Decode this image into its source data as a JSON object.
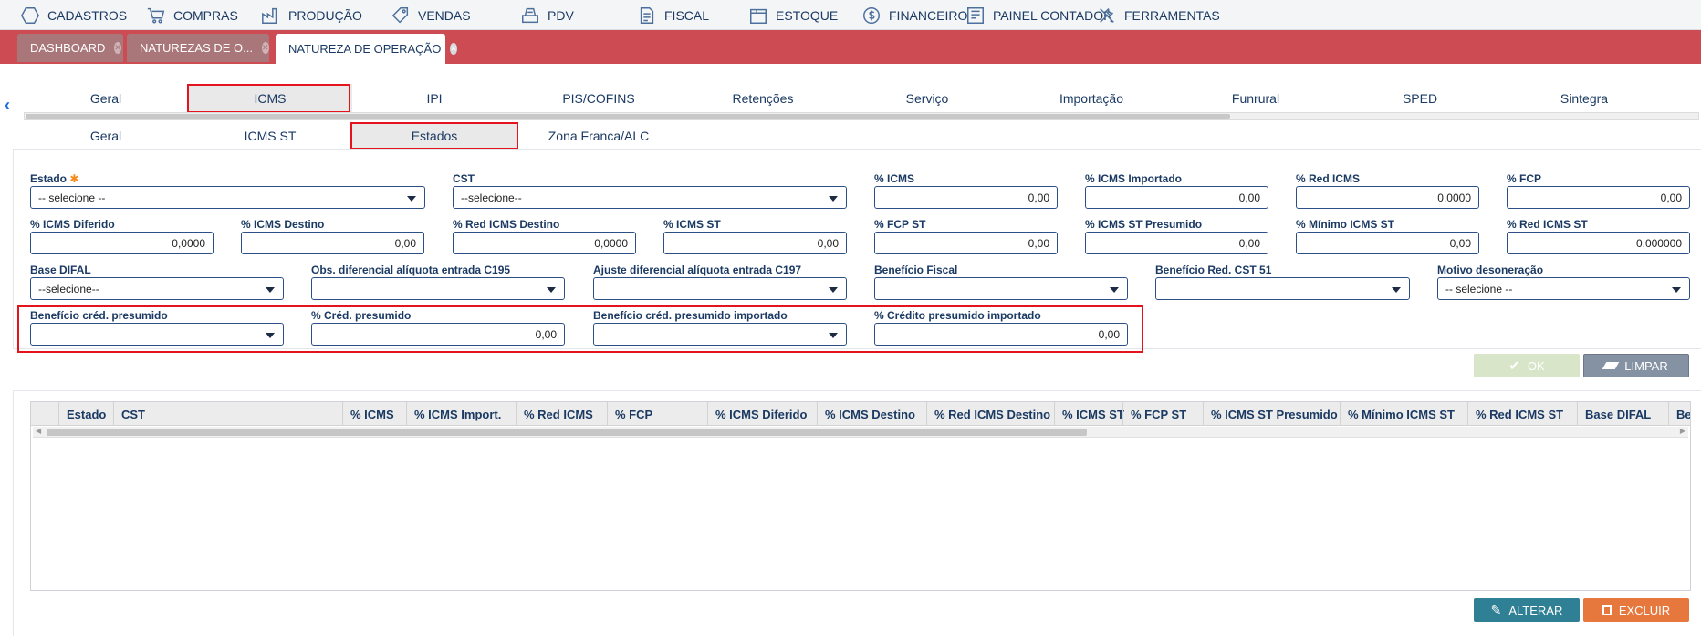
{
  "top_menu": [
    {
      "label": "CADASTROS",
      "icon": "hexagon-icon"
    },
    {
      "label": "COMPRAS",
      "icon": "cart-icon"
    },
    {
      "label": "PRODUÇÃO",
      "icon": "factory-icon"
    },
    {
      "label": "VENDAS",
      "icon": "tag-icon"
    },
    {
      "label": "PDV",
      "icon": "register-icon"
    },
    {
      "label": "FISCAL",
      "icon": "document-icon"
    },
    {
      "label": "ESTOQUE",
      "icon": "box-icon"
    },
    {
      "label": "FINANCEIRO",
      "icon": "dollar-icon"
    },
    {
      "label": "PAINEL CONTADOR",
      "icon": "panel-icon"
    },
    {
      "label": "FERRAMENTAS",
      "icon": "tools-icon"
    }
  ],
  "doc_tabs": [
    {
      "label": "DASHBOARD",
      "active": false
    },
    {
      "label": "NATUREZAS DE O...",
      "active": false
    },
    {
      "label": "NATUREZA DE OPERAÇÃO",
      "active": true
    }
  ],
  "main_tabs": [
    "Geral",
    "ICMS",
    "IPI",
    "PIS/COFINS",
    "Retenções",
    "Serviço",
    "Importação",
    "Funrural",
    "SPED",
    "Sintegra"
  ],
  "main_tab_selected": "ICMS",
  "sub_tabs": [
    "Geral",
    "ICMS ST",
    "Estados",
    "Zona Franca/ALC"
  ],
  "sub_tab_selected": "Estados",
  "form": {
    "estado": {
      "label": "Estado",
      "value": "-- selecione --"
    },
    "cst": {
      "label": "CST",
      "value": "--selecione--"
    },
    "pct_icms": {
      "label": "% ICMS",
      "value": "0,00"
    },
    "pct_icms_importado": {
      "label": "% ICMS Importado",
      "value": "0,00"
    },
    "pct_red_icms": {
      "label": "% Red ICMS",
      "value": "0,0000"
    },
    "pct_fcp": {
      "label": "% FCP",
      "value": "0,00"
    },
    "pct_icms_diferido": {
      "label": "% ICMS Diferido",
      "value": "0,0000"
    },
    "pct_icms_destino": {
      "label": "% ICMS Destino",
      "value": "0,00"
    },
    "pct_red_icms_destino": {
      "label": "% Red ICMS Destino",
      "value": "0,0000"
    },
    "pct_icms_st": {
      "label": "% ICMS ST",
      "value": "0,00"
    },
    "pct_fcp_st": {
      "label": "% FCP ST",
      "value": "0,00"
    },
    "pct_icms_st_presumido": {
      "label": "% ICMS ST Presumido",
      "value": "0,00"
    },
    "pct_minimo_icms_st": {
      "label": "% Mínimo ICMS ST",
      "value": "0,00"
    },
    "pct_red_icms_st": {
      "label": "% Red ICMS ST",
      "value": "0,000000"
    },
    "base_difal": {
      "label": "Base DIFAL",
      "value": "--selecione--"
    },
    "obs_diferencial": {
      "label": "Obs. diferencial alíquota entrada C195",
      "value": ""
    },
    "ajuste_diferencial": {
      "label": "Ajuste diferencial alíquota entrada C197",
      "value": ""
    },
    "beneficio_fiscal": {
      "label": "Benefício Fiscal",
      "value": ""
    },
    "beneficio_red_cst51": {
      "label": "Benefício Red. CST 51",
      "value": ""
    },
    "motivo_desoneracao": {
      "label": "Motivo desoneração",
      "value": "-- selecione --"
    },
    "beneficio_cred_presumido": {
      "label": "Benefício créd. presumido",
      "value": ""
    },
    "pct_cred_presumido": {
      "label": "% Créd. presumido",
      "value": "0,00"
    },
    "beneficio_cred_presumido_importado": {
      "label": "Benefício créd. presumido importado",
      "value": ""
    },
    "pct_credito_presumido_importado": {
      "label": "% Crédito presumido importado",
      "value": "0,00"
    }
  },
  "buttons": {
    "ok": "OK",
    "limpar": "LIMPAR",
    "alterar": "ALTERAR",
    "excluir": "EXCLUIR"
  },
  "grid": {
    "columns": [
      "Estado",
      "CST",
      "% ICMS",
      "% ICMS Import.",
      "% Red ICMS",
      "% FCP",
      "% ICMS Diferido",
      "% ICMS Destino",
      "% Red ICMS Destino",
      "% ICMS ST",
      "% FCP ST",
      "% ICMS ST Presumido",
      "% Mínimo ICMS ST",
      "% Red ICMS ST",
      "Base DIFAL",
      "Benefíc"
    ],
    "rows": []
  },
  "colors": {
    "accent_red": "#cd4c54",
    "ok_button": "#d8e5c8",
    "limpar_button": "#8592a3",
    "alterar_button": "#2f7f95",
    "excluir_button": "#e6773d",
    "required_star": "#f28c1c",
    "highlight_box": "#e3141b"
  }
}
